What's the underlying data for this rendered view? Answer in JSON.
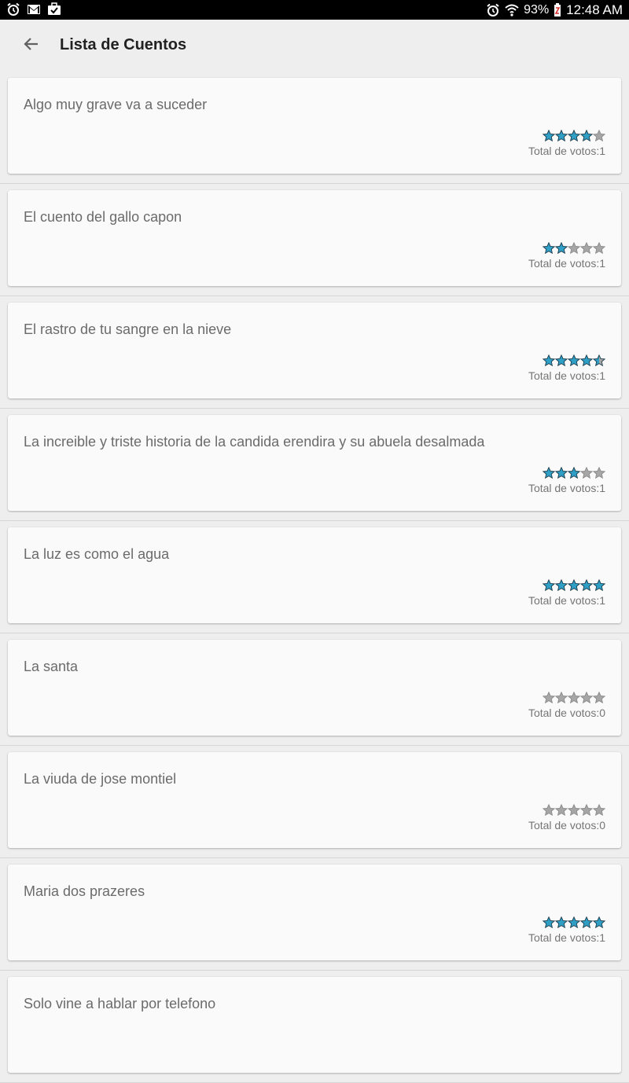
{
  "status_bar": {
    "left_icons": [
      "alarm-icon",
      "gmail-icon",
      "task-icon"
    ],
    "battery": "93%",
    "time": "12:48 AM"
  },
  "app_bar": {
    "back_icon": "arrow-back-icon",
    "title": "Lista de Cuentos"
  },
  "colors": {
    "star_filled": "#2f9fc6",
    "star_empty": "#a6a6a6",
    "star_outline": "#1d3b4a"
  },
  "stories": [
    {
      "title": "Algo muy grave va a suceder",
      "rating": 4,
      "votes_text": "Total de votos:1"
    },
    {
      "title": "El cuento del gallo capon",
      "rating": 2,
      "votes_text": "Total de votos:1"
    },
    {
      "title": "El rastro de tu sangre en la nieve",
      "rating": 4.5,
      "votes_text": "Total de votos:1"
    },
    {
      "title": "La increible y triste historia de la candida erendira y su abuela desalmada",
      "rating": 3,
      "votes_text": "Total de votos:1"
    },
    {
      "title": "La luz es como el agua",
      "rating": 5,
      "votes_text": "Total de votos:1"
    },
    {
      "title": "La santa",
      "rating": 0,
      "votes_text": "Total de votos:0"
    },
    {
      "title": "La viuda de jose montiel",
      "rating": 0,
      "votes_text": "Total de votos:0"
    },
    {
      "title": "Maria dos prazeres",
      "rating": 5,
      "votes_text": "Total de votos:1"
    },
    {
      "title": "Solo vine a hablar por telefono",
      "rating": null,
      "votes_text": ""
    }
  ]
}
